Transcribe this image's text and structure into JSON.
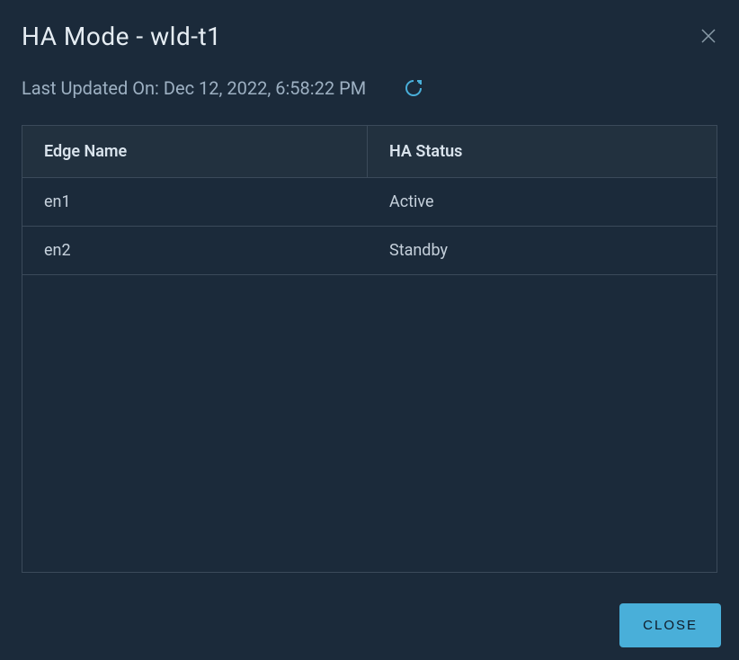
{
  "dialog": {
    "title": "HA Mode - wld-t1",
    "lastUpdatedLabel": "Last Updated On: Dec 12, 2022, 6:58:22 PM",
    "closeLabel": "CLOSE"
  },
  "table": {
    "columns": {
      "edgeName": "Edge Name",
      "haStatus": "HA Status"
    },
    "rows": [
      {
        "edgeName": "en1",
        "haStatus": "Active"
      },
      {
        "edgeName": "en2",
        "haStatus": "Standby"
      }
    ]
  }
}
